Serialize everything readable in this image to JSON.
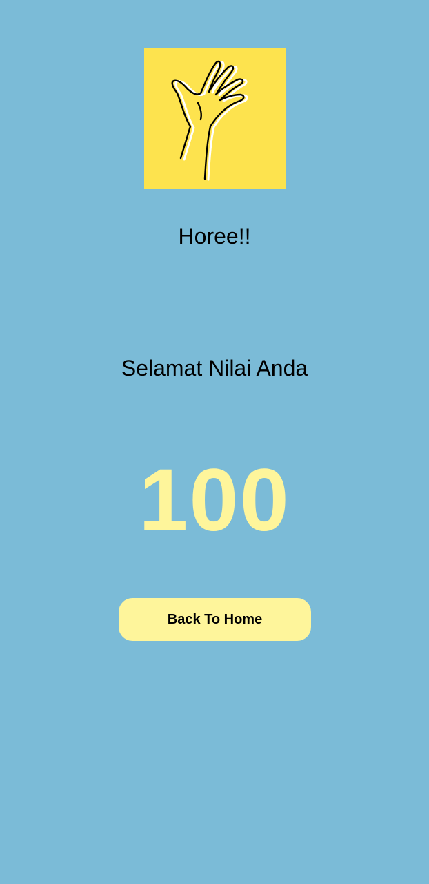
{
  "colors": {
    "background": "#7bbbd7",
    "card": "#fde34e",
    "score": "#fef59b",
    "button": "#fef59b",
    "text": "#000000"
  },
  "hero": {
    "icon": "waving-hand-icon"
  },
  "result": {
    "title": "Horee!!",
    "subtitle": "Selamat Nilai Anda",
    "score": "100"
  },
  "actions": {
    "home_label": "Back To Home"
  }
}
